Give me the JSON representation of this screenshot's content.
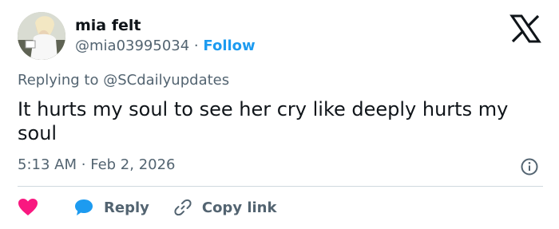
{
  "author": {
    "name": "mia felt",
    "handle": "@mia03995034",
    "separator": "·",
    "follow_label": "Follow"
  },
  "brand": {
    "logo_icon": "x-logo-icon",
    "accent": "#1d9bf0",
    "like": "#f91880"
  },
  "reply": {
    "text": "Replying to @SCdailyupdates"
  },
  "tweet": {
    "text": "It hurts my soul to see her cry like deeply hurts my soul"
  },
  "meta": {
    "time": "5:13 AM",
    "separator": "·",
    "date": "Feb 2, 2026",
    "info_icon": "info-icon"
  },
  "actions": {
    "like_icon": "heart-icon",
    "reply_icon": "speech-bubble-icon",
    "reply_label": "Reply",
    "copy_icon": "link-icon",
    "copy_label": "Copy link"
  }
}
